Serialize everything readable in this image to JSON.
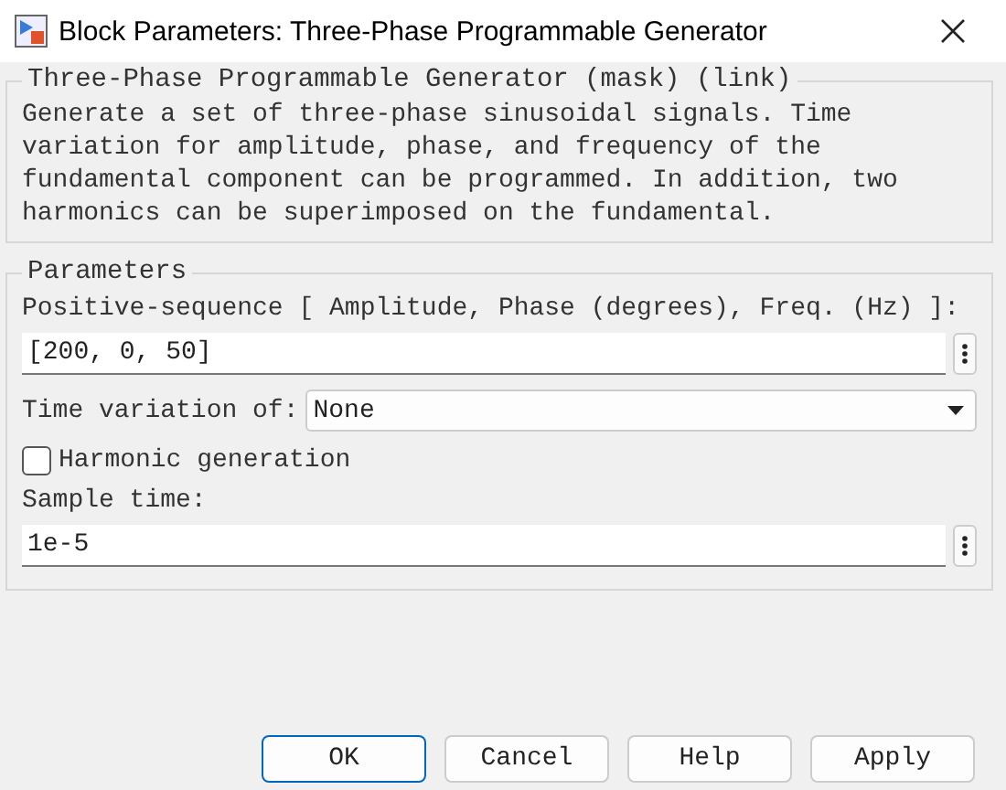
{
  "window": {
    "title": "Block Parameters: Three-Phase Programmable Generator"
  },
  "mask": {
    "title": "Three-Phase Programmable Generator (mask) (link)",
    "description": "Generate a set of three-phase sinusoidal signals. Time variation for amplitude, phase, and frequency of the fundamental component can be programmed. In addition, two harmonics can be superimposed on the fundamental."
  },
  "parameters": {
    "title": "Parameters",
    "items": [
      {
        "kind": "edit",
        "label": "Positive-sequence [ Amplitude, Phase (degrees), Freq. (Hz) ]:",
        "value": "[200, 0, 50]"
      },
      {
        "kind": "popup",
        "label": "Time variation of:",
        "value": "None"
      },
      {
        "kind": "checkbox",
        "label": "Harmonic generation",
        "checked": false
      },
      {
        "kind": "edit",
        "label": "Sample time:",
        "value": "1e-5"
      }
    ]
  },
  "buttons": [
    {
      "label": "OK",
      "default": true
    },
    {
      "label": "Cancel",
      "default": false
    },
    {
      "label": "Help",
      "default": false
    },
    {
      "label": "Apply",
      "default": false
    }
  ]
}
